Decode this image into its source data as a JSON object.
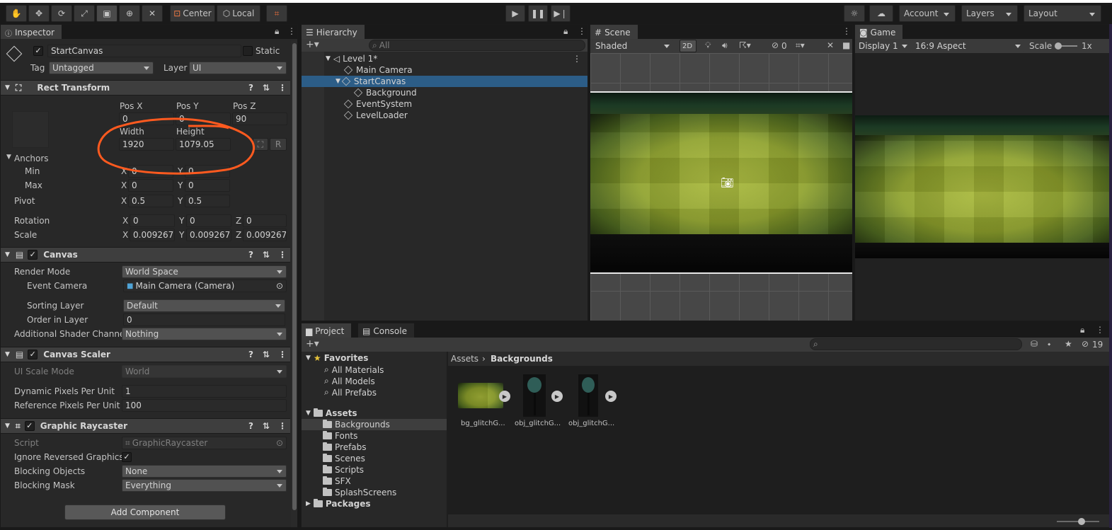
{
  "toolbar": {
    "pivot_label": "Center",
    "space_label": "Local",
    "account_label": "Account",
    "layers_label": "Layers",
    "layout_label": "Layout"
  },
  "inspector": {
    "tab": "Inspector",
    "object_name": "StartCanvas",
    "static_label": "Static",
    "tag_label": "Tag",
    "tag_value": "Untagged",
    "layer_label": "Layer",
    "layer_value": "UI",
    "rect_transform": {
      "title": "Rect Transform",
      "posx_label": "Pos X",
      "posx": "0",
      "posy_label": "Pos Y",
      "posy": "0",
      "posz_label": "Pos Z",
      "posz": "90",
      "width_label": "Width",
      "width": "1920",
      "height_label": "Height",
      "height": "1079.05",
      "r_label": "R",
      "anchors_label": "Anchors",
      "min_label": "Min",
      "min_x": "0",
      "min_y": "0",
      "max_label": "Max",
      "max_x": "0",
      "max_y": "0",
      "pivot_label": "Pivot",
      "pivot_x": "0.5",
      "pivot_y": "0.5",
      "rotation_label": "Rotation",
      "rot_x": "0",
      "rot_y": "0",
      "rot_z": "0",
      "scale_label": "Scale",
      "scale_x": "0.009267",
      "scale_y": "0.009267",
      "scale_z": "0.009267",
      "x": "X",
      "y": "Y",
      "z": "Z"
    },
    "canvas": {
      "title": "Canvas",
      "render_mode_label": "Render Mode",
      "render_mode": "World Space",
      "event_camera_label": "Event Camera",
      "event_camera": "Main Camera (Camera)",
      "sorting_layer_label": "Sorting Layer",
      "sorting_layer": "Default",
      "order_label": "Order in Layer",
      "order": "0",
      "shader_label": "Additional Shader Channel",
      "shader": "Nothing"
    },
    "canvas_scaler": {
      "title": "Canvas Scaler",
      "ui_scale_label": "UI Scale Mode",
      "ui_scale": "World",
      "dynamic_label": "Dynamic Pixels Per Unit",
      "dynamic": "1",
      "reference_label": "Reference Pixels Per Unit",
      "reference": "100"
    },
    "raycaster": {
      "title": "Graphic Raycaster",
      "script_label": "Script",
      "script": "GraphicRaycaster",
      "ignore_label": "Ignore Reversed Graphics",
      "blocking_objects_label": "Blocking Objects",
      "blocking_objects": "None",
      "blocking_mask_label": "Blocking Mask",
      "blocking_mask": "Everything"
    },
    "add_component": "Add Component"
  },
  "hierarchy": {
    "tab": "Hierarchy",
    "search_placeholder": "All",
    "items": [
      {
        "label": "Level 1*"
      },
      {
        "label": "Main Camera"
      },
      {
        "label": "StartCanvas"
      },
      {
        "label": "Background"
      },
      {
        "label": "EventSystem"
      },
      {
        "label": "LevelLoader"
      }
    ]
  },
  "scene": {
    "tab": "Scene",
    "shading": "Shaded",
    "mode_2d": "2D",
    "hidden_count": "0"
  },
  "game": {
    "tab": "Game",
    "display": "Display 1",
    "aspect": "16:9 Aspect",
    "scale_label": "Scale",
    "scale_value": "1x"
  },
  "project": {
    "tab_project": "Project",
    "tab_console": "Console",
    "hidden_count": "19",
    "favorites_label": "Favorites",
    "favorites": [
      "All Materials",
      "All Models",
      "All Prefabs"
    ],
    "assets_label": "Assets",
    "folders": [
      "Backgrounds",
      "Fonts",
      "Prefabs",
      "Scenes",
      "Scripts",
      "SFX",
      "SplashScreens"
    ],
    "packages_label": "Packages",
    "breadcrumb_root": "Assets",
    "breadcrumb_current": "Backgrounds",
    "assets": [
      "bg_glitchG...",
      "obj_glitchG...",
      "obj_glitchG..."
    ]
  },
  "colors": {
    "selection": "#2c5d87",
    "annotation": "#ff5a1f"
  }
}
